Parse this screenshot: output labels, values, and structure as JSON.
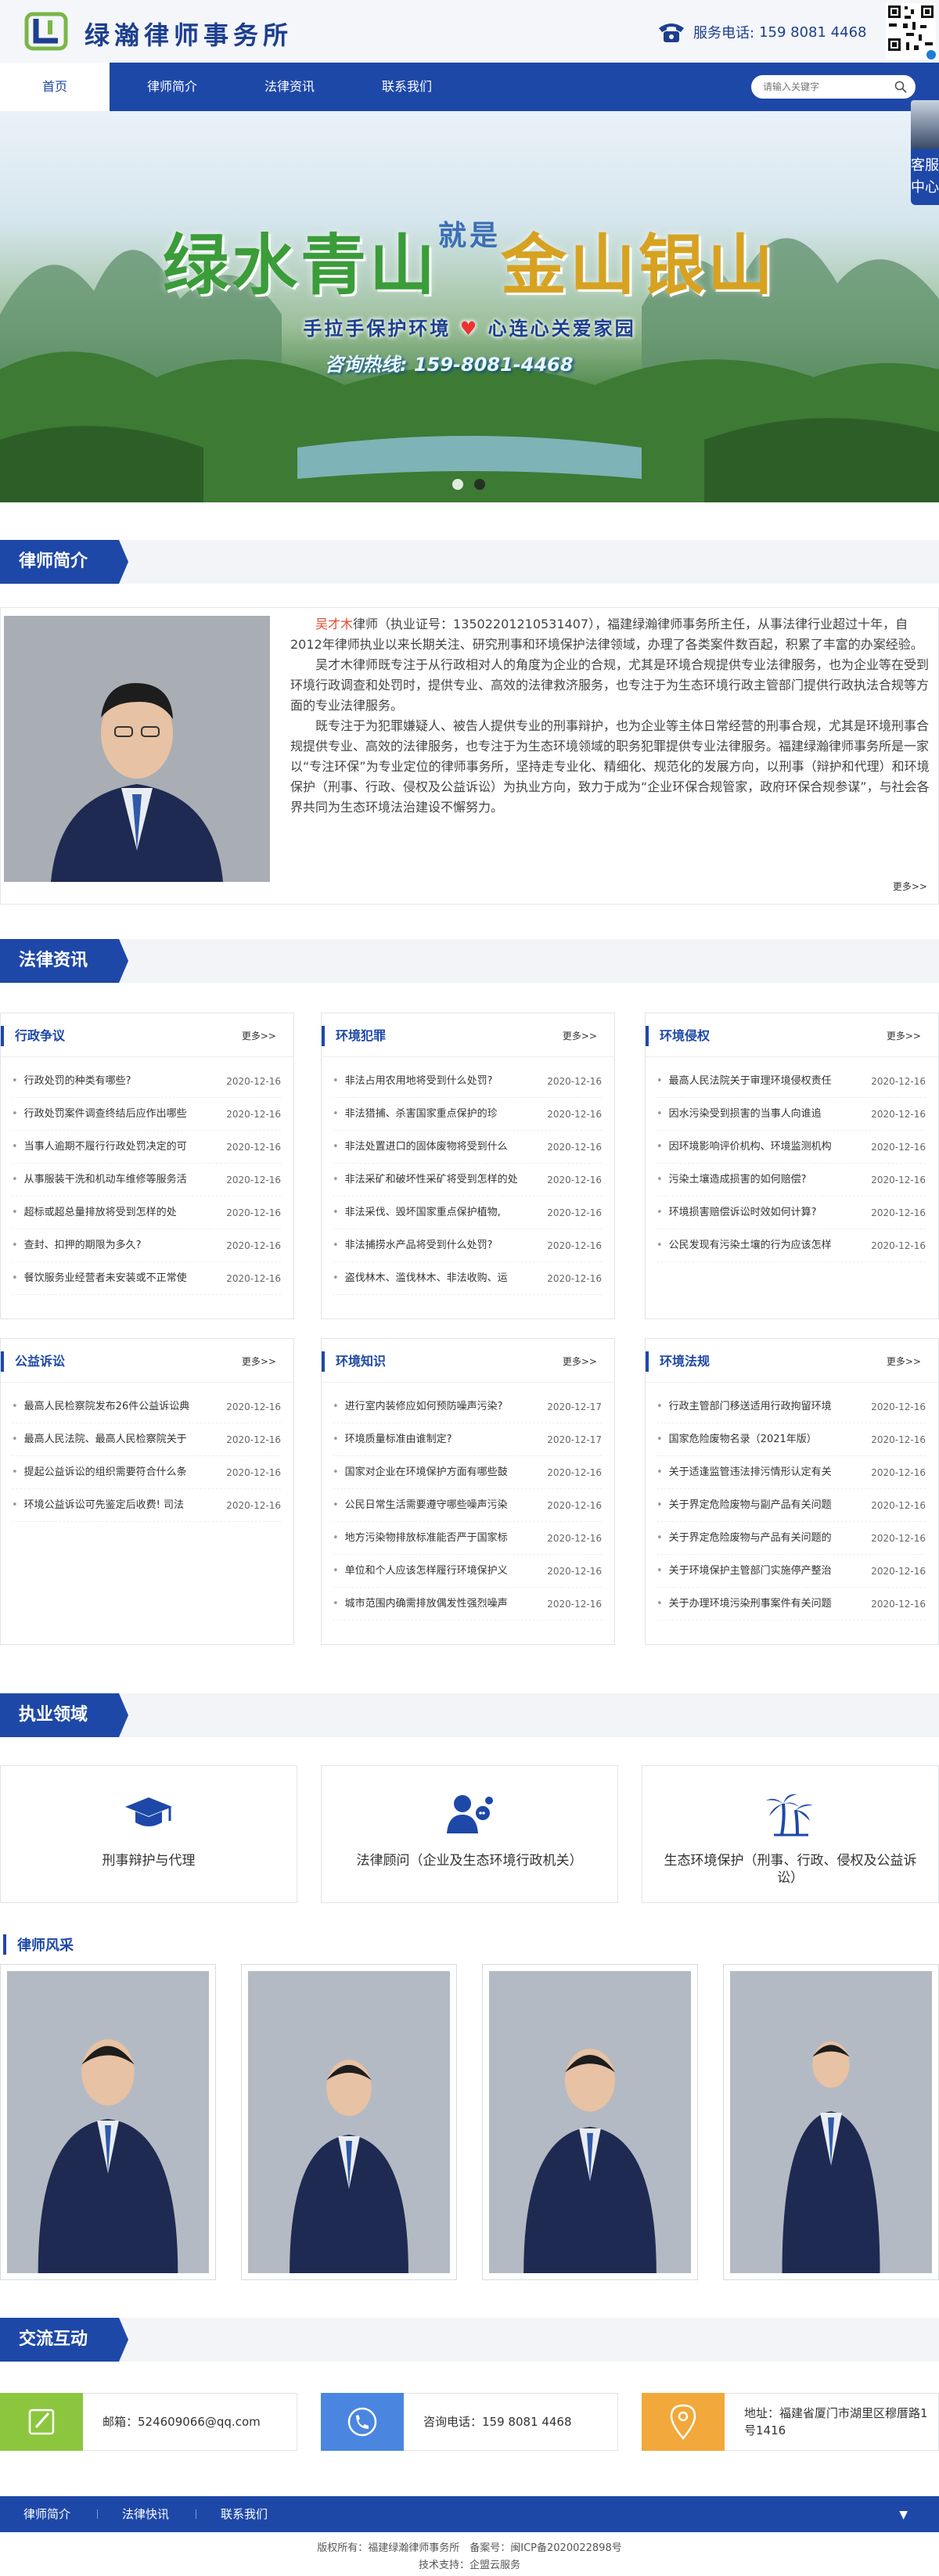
{
  "header": {
    "site_name": "绿瀚律师事务所",
    "hotline_label": "服务电话:",
    "hotline_number": "159 8081 4468"
  },
  "nav": {
    "items": [
      "首页",
      "律师简介",
      "法律资讯",
      "联系我们"
    ],
    "search_placeholder": "请输入关键字"
  },
  "banner": {
    "title_a": "绿水青山",
    "title_joint_1": "就",
    "title_joint_2": "是",
    "title_b": "金山银山",
    "subtitle_a": "手拉手保护环境",
    "subtitle_b": "心连心关爱家园",
    "hotline": "咨询热线: 159-8081-4468"
  },
  "kefu": {
    "label": "客服中心"
  },
  "sections": {
    "intro": "律师简介",
    "news": "法律资讯",
    "practice": "执业领域",
    "gallery": "律师风采",
    "interaction": "交流互动"
  },
  "intro": {
    "name": "吴才木",
    "p1_rest": "律师（执业证号：13502201210531407），福建绿瀚律师事务所主任，从事法律行业超过十年，自2012年律师执业以来长期关注、研究刑事和环境保护法律领域，办理了各类案件数百起，积累了丰富的办案经验。",
    "p2": "吴才木律师既专注于从行政相对人的角度为企业的合规，尤其是环境合规提供专业法律服务，也为企业等在受到环境行政调查和处罚时，提供专业、高效的法律救济服务，也专注于为生态环境行政主管部门提供行政执法合规等方面的专业法律服务。",
    "p3": "既专注于为犯罪嫌疑人、被告人提供专业的刑事辩护，也为企业等主体日常经营的刑事合规，尤其是环境刑事合规提供专业、高效的法律服务，也专注于为生态环境领域的职务犯罪提供专业法律服务。福建绿瀚律师事务所是一家以“专注环保”为专业定位的律师事务所，坚持走专业化、精细化、规范化的发展方向，以刑事（辩护和代理）和环境保护（刑事、行政、侵权及公益诉讼）为执业方向，致力于成为“企业环保合规管家，政府环保合规参谋”，与社会各界共同为生态环境法治建设不懈努力。",
    "more": "更多>>"
  },
  "news": [
    {
      "title": "行政争议",
      "more": "更多>>",
      "items": [
        {
          "t": "行政处罚的种类有哪些?",
          "d": "2020-12-16"
        },
        {
          "t": "行政处罚案件调查终结后应作出哪些",
          "d": "2020-12-16"
        },
        {
          "t": "当事人逾期不履行行政处罚决定的可",
          "d": "2020-12-16"
        },
        {
          "t": "从事服装干洗和机动车维修等服务活",
          "d": "2020-12-16"
        },
        {
          "t": "超标或超总量排放将受到怎样的处",
          "d": "2020-12-16"
        },
        {
          "t": "查封、扣押的期限为多久?",
          "d": "2020-12-16"
        },
        {
          "t": "餐饮服务业经营者未安装或不正常使",
          "d": "2020-12-16"
        }
      ]
    },
    {
      "title": "环境犯罪",
      "more": "更多>>",
      "items": [
        {
          "t": "非法占用农用地将受到什么处罚?",
          "d": "2020-12-16"
        },
        {
          "t": "非法猎捕、杀害国家重点保护的珍",
          "d": "2020-12-16"
        },
        {
          "t": "非法处置进口的固体废物将受到什么",
          "d": "2020-12-16"
        },
        {
          "t": "非法采矿和破坏性采矿将受到怎样的处",
          "d": "2020-12-16"
        },
        {
          "t": "非法采伐、毁坏国家重点保护植物,",
          "d": "2020-12-16"
        },
        {
          "t": "非法捕捞水产品将受到什么处罚?",
          "d": "2020-12-16"
        },
        {
          "t": "盗伐林木、滥伐林木、非法收购、运",
          "d": "2020-12-16"
        }
      ]
    },
    {
      "title": "环境侵权",
      "more": "更多>>",
      "items": [
        {
          "t": "最高人民法院关于审理环境侵权责任",
          "d": "2020-12-16"
        },
        {
          "t": "因水污染受到损害的当事人向谁追",
          "d": "2020-12-16"
        },
        {
          "t": "因环境影响评价机构、环境监测机构",
          "d": "2020-12-16"
        },
        {
          "t": "污染土壤造成损害的如何赔偿?",
          "d": "2020-12-16"
        },
        {
          "t": "环境损害赔偿诉讼时效如何计算?",
          "d": "2020-12-16"
        },
        {
          "t": "公民发现有污染土壤的行为应该怎样",
          "d": "2020-12-16"
        }
      ]
    },
    {
      "title": "公益诉讼",
      "more": "更多>>",
      "items": [
        {
          "t": "最高人民检察院发布26件公益诉讼典",
          "d": "2020-12-16"
        },
        {
          "t": "最高人民法院、最高人民检察院关于",
          "d": "2020-12-16"
        },
        {
          "t": "提起公益诉讼的组织需要符合什么条",
          "d": "2020-12-16"
        },
        {
          "t": "环境公益诉讼可先鉴定后收费! 司法",
          "d": "2020-12-16"
        }
      ]
    },
    {
      "title": "环境知识",
      "more": "更多>>",
      "items": [
        {
          "t": "进行室内装修应如何预防噪声污染?",
          "d": "2020-12-17"
        },
        {
          "t": "环境质量标准由谁制定?",
          "d": "2020-12-17"
        },
        {
          "t": "国家对企业在环境保护方面有哪些鼓",
          "d": "2020-12-16"
        },
        {
          "t": "公民日常生活需要遵守哪些噪声污染",
          "d": "2020-12-16"
        },
        {
          "t": "地方污染物排放标准能否严于国家标",
          "d": "2020-12-16"
        },
        {
          "t": "单位和个人应该怎样履行环境保护义",
          "d": "2020-12-16"
        },
        {
          "t": "城市范围内确需排放偶发性强烈噪声",
          "d": "2020-12-16"
        }
      ]
    },
    {
      "title": "环境法规",
      "more": "更多>>",
      "items": [
        {
          "t": "行政主管部门移送适用行政拘留环境",
          "d": "2020-12-16"
        },
        {
          "t": "国家危险废物名录（2021年版）",
          "d": "2020-12-16"
        },
        {
          "t": "关于适逢监管违法排污情形认定有关",
          "d": "2020-12-16"
        },
        {
          "t": "关于界定危险废物与副产品有关问题",
          "d": "2020-12-16"
        },
        {
          "t": "关于界定危险废物与产品有关问题的",
          "d": "2020-12-16"
        },
        {
          "t": "关于环境保护主管部门实施停产整治",
          "d": "2020-12-16"
        },
        {
          "t": "关于办理环境污染刑事案件有关问题",
          "d": "2020-12-16"
        }
      ]
    }
  ],
  "practice": [
    {
      "label": "刑事辩护与代理",
      "icon": "graduation-cap-icon"
    },
    {
      "label": "法律顾问（企业及生态环境行政机关）",
      "icon": "consultant-icon"
    },
    {
      "label": "生态环境保护（刑事、行政、侵权及公益诉讼）",
      "icon": "palm-tree-icon"
    }
  ],
  "contact": [
    {
      "label": "邮箱：524609066@qq.com",
      "color": "#8cc63f",
      "icon": "edit-icon"
    },
    {
      "label": "咨询电话：159 8081 4468",
      "color": "#4a86e0",
      "icon": "phone-icon"
    },
    {
      "label": "地址：福建省厦门市湖里区穆厝路1号1416",
      "color": "#f2a83a",
      "icon": "location-icon"
    }
  ],
  "footer": {
    "nav": [
      "律师简介",
      "法律快讯",
      "联系我们"
    ],
    "copyright": "版权所有：福建绿瀚律师事务所　备案号：闽ICP备2020022898号",
    "support": "技术支持：企盟云服务"
  },
  "colors": {
    "brand": "#1e48a8",
    "accent": "#e24b2b"
  }
}
